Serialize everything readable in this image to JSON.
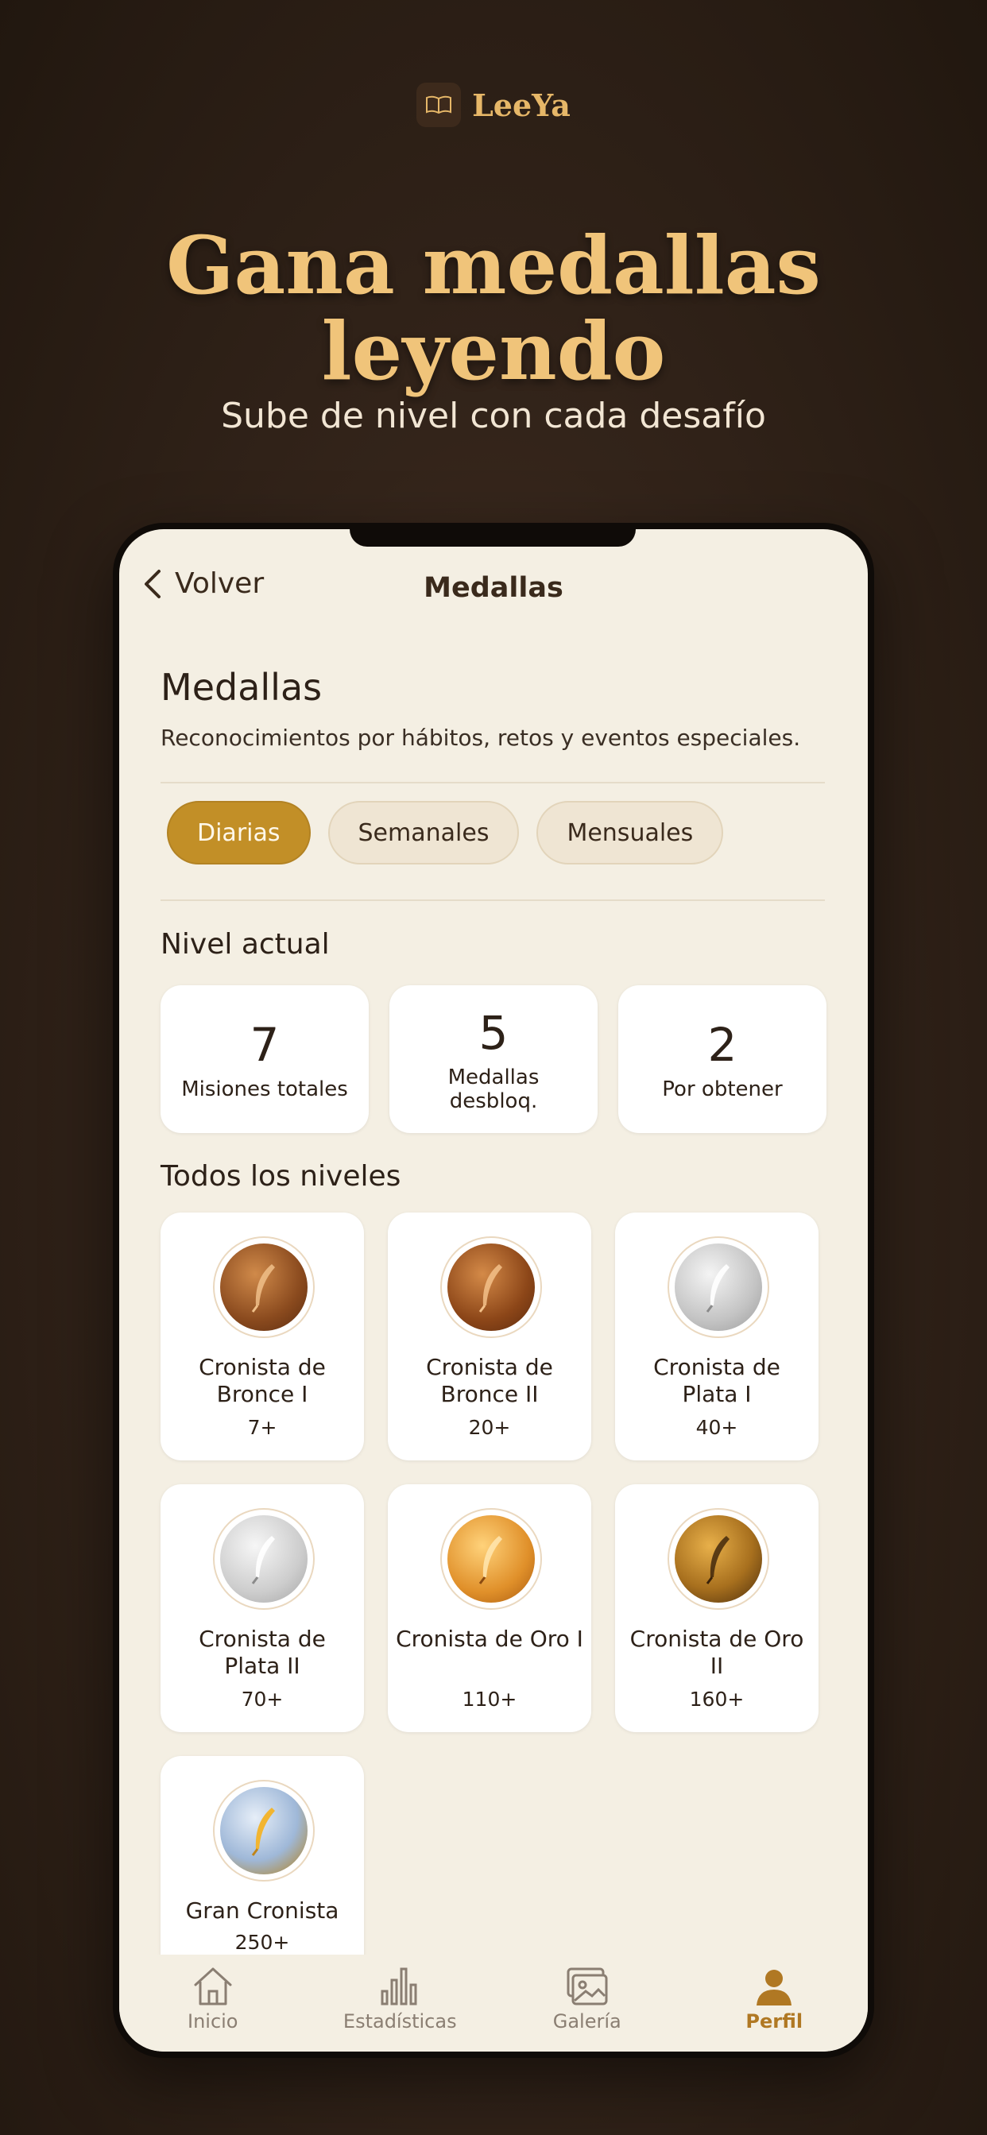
{
  "brand": {
    "name": "LeeYa",
    "logo_icon": "book-icon"
  },
  "hero": {
    "title_line1": "Gana medallas",
    "title_line2": "leyendo",
    "subtitle": "Sube de nivel con cada desafío"
  },
  "nav": {
    "back_label": "Volver",
    "title": "Medallas"
  },
  "section": {
    "title": "Medallas",
    "description": "Reconocimientos por hábitos, retos y eventos especiales."
  },
  "tabs": [
    {
      "label": "Diarias",
      "active": true
    },
    {
      "label": "Semanales",
      "active": false
    },
    {
      "label": "Mensuales",
      "active": false
    }
  ],
  "current_level": {
    "title": "Nivel actual",
    "stats": [
      {
        "value": "7",
        "label": "Misiones totales"
      },
      {
        "value": "5",
        "label": "Medallas desbloq."
      },
      {
        "value": "2",
        "label": "Por obtener"
      }
    ]
  },
  "levels": {
    "title": "Todos los niveles",
    "items": [
      {
        "name": "Cronista de Bronce I",
        "range": "7+",
        "tier": "bronze"
      },
      {
        "name": "Cronista de Bronce II",
        "range": "20+",
        "tier": "bronze"
      },
      {
        "name": "Cronista de Plata I",
        "range": "40+",
        "tier": "silver"
      },
      {
        "name": "Cronista de Plata II",
        "range": "70+",
        "tier": "silver"
      },
      {
        "name": "Cronista de Oro I",
        "range": "110+",
        "tier": "gold"
      },
      {
        "name": "Cronista de Oro II",
        "range": "160+",
        "tier": "dark-gold"
      },
      {
        "name": "Gran Cronista",
        "range": "250+",
        "tier": "grand"
      }
    ]
  },
  "bottom_nav": [
    {
      "label": "Inicio",
      "icon": "home-icon",
      "active": false
    },
    {
      "label": "Estadísticas",
      "icon": "bar-chart-icon",
      "active": false
    },
    {
      "label": "Galería",
      "icon": "gallery-icon",
      "active": false
    },
    {
      "label": "Perfil",
      "icon": "user-icon",
      "active": true
    }
  ],
  "colors": {
    "accent": "#c28f27",
    "hero_title": "#f0c47a",
    "background": "#2a1d14",
    "screen": "#f4efe3"
  }
}
